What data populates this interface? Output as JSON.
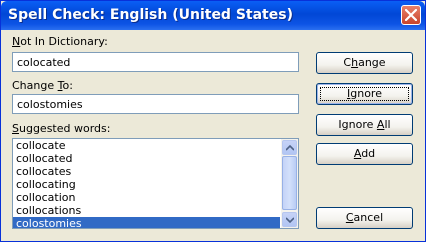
{
  "window": {
    "title": "Spell Check: English (United States)"
  },
  "not_in_dictionary": {
    "label_pre": "",
    "label_key": "N",
    "label_post": "ot In Dictionary:",
    "value": "colocated"
  },
  "change_to": {
    "label_pre": "Change ",
    "label_key": "T",
    "label_post": "o:",
    "value": "colostomies"
  },
  "suggested": {
    "label_pre": "",
    "label_key": "S",
    "label_post": "uggested words:",
    "items": [
      "collocate",
      "collocated",
      "collocates",
      "collocating",
      "collocation",
      "collocations",
      "colostomies"
    ],
    "selected": "colostomies"
  },
  "buttons": {
    "change": {
      "pre": "C",
      "key": "h",
      "post": "ange"
    },
    "ignore": {
      "pre": "",
      "key": "I",
      "post": "gnore"
    },
    "ignore_all": {
      "pre": "Ignore ",
      "key": "A",
      "post": "ll"
    },
    "add": {
      "pre": "",
      "key": "A",
      "post": "dd"
    },
    "cancel": {
      "pre": "",
      "key": "C",
      "post": "ancel"
    }
  },
  "colors": {
    "titlebar": "#0147d6",
    "selection": "#316ac5",
    "face": "#ece9d8"
  },
  "icons": {
    "close": "close-icon",
    "scroll_up": "scroll-up-arrow-icon",
    "scroll_down": "scroll-down-arrow-icon"
  }
}
